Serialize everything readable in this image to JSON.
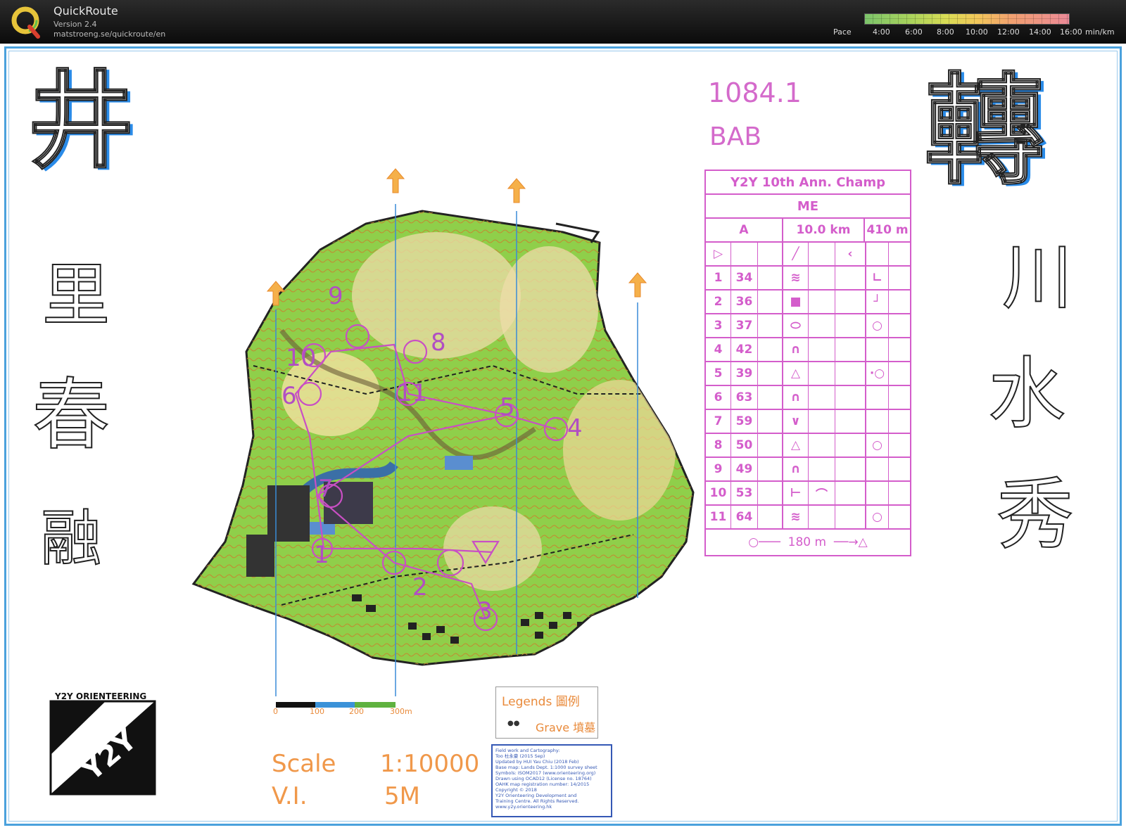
{
  "app": {
    "name": "QuickRoute",
    "version": "Version 2.4",
    "url": "matstroeng.se/quickroute/en"
  },
  "pace_scale": {
    "label": "Pace",
    "ticks": [
      "4:00",
      "6:00",
      "8:00",
      "10:00",
      "12:00",
      "14:00",
      "16:00"
    ],
    "unit": "min/km",
    "colors": [
      "#7cc46b",
      "#d9dc55",
      "#ec8a98"
    ]
  },
  "map": {
    "course_number": "1084.1",
    "course_name": "BAB",
    "title_chars_left": [
      "井",
      "里",
      "春",
      "融"
    ],
    "title_chars_right": [
      "轉",
      "川",
      "水",
      "秀"
    ],
    "controls_on_map": [
      "9",
      "10",
      "8",
      "11",
      "6",
      "5",
      "4",
      "7",
      "1",
      "2",
      "3"
    ],
    "scale_label": "Scale",
    "scale_value": "1:10000",
    "vi_label": "V.I.",
    "vi_value": "5M",
    "scalebar_ticks": [
      "0",
      "100",
      "200",
      "300m"
    ],
    "legend_title": "Legends 圖例",
    "legend_item": "Grave 墳墓",
    "club_name": "Y2Y ORIENTEERING",
    "credits": [
      "Field work and Cartography:",
      "Too 杜永豪 (2015 Sep)",
      "Updated by HUI Yau Chiu (2018 Feb)",
      "Base map: Lands Dept. 1:1000 survey sheet",
      "Symbols: ISOM2017 (www.orienteering.org)",
      "Drawn using OCAD12 (License no. 18764)",
      "OAHK map registration number: 14/2015",
      "Copyright © 2018",
      "Y2Y Orienteering Development and",
      "Training Centre. All Rights Reserved.",
      "www.y2y.orienteering.hk"
    ],
    "accent": "#d45dcb"
  },
  "description_sheet": {
    "event": "Y2Y 10th Ann. Champ",
    "class": "ME",
    "course": "A",
    "length": "10.0 km",
    "climb": "410 m",
    "controls": [
      {
        "n": "1",
        "code": "34"
      },
      {
        "n": "2",
        "code": "36"
      },
      {
        "n": "3",
        "code": "37"
      },
      {
        "n": "4",
        "code": "42"
      },
      {
        "n": "5",
        "code": "39"
      },
      {
        "n": "6",
        "code": "63"
      },
      {
        "n": "7",
        "code": "59"
      },
      {
        "n": "8",
        "code": "50"
      },
      {
        "n": "9",
        "code": "49"
      },
      {
        "n": "10",
        "code": "53"
      },
      {
        "n": "11",
        "code": "64"
      }
    ],
    "finish": "180 m"
  }
}
